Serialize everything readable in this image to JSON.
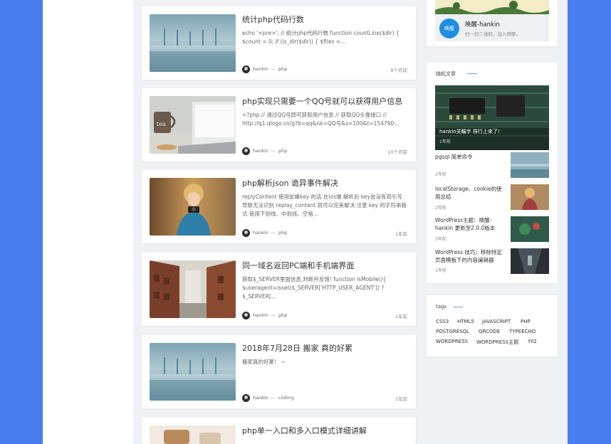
{
  "posts": [
    {
      "title": "统计php代码行数",
      "excerpt": "echo '<pre>'; // 统计php代码行数 function countLine($dir) { $count = 0; if (is_dir($dir)) { $files =…",
      "author": "hankin",
      "dash": "—",
      "category": "php",
      "time": "8个月前",
      "thumb_icon": "bridge-photo"
    },
    {
      "title": "php实现只需要一个QQ号就可以获得用户信息",
      "excerpt": "<?php // 通过QQ号即可获取用户信息 // 获取QQ头像接口 // http://q1.qlogo.cn/g?b=qq&nk=QQ号&s=100&t=154790…",
      "author": "hankin",
      "dash": "—",
      "category": "php",
      "time": "10个月前",
      "thumb_icon": "mug-laptop-photo"
    },
    {
      "title": "php解析json 诡异事件解决",
      "excerpt": "replyContent 使用驼峰key 的话 在ios端 解析后 key会没有双引号导致无法识别 replay_content 就可以完美解决 注意 key 的字符串格式 使用下划线、中划线、空格…",
      "author": "hankin",
      "dash": "—",
      "category": "php",
      "time": "1年前",
      "thumb_icon": "girl-camera-photo"
    },
    {
      "title": "同一域名返回PC端和手机端界面",
      "excerpt": "获取$_SERVER里面信息,判断并反馈! function isMobile(){ $useragent=isset($_SERVER['HTTP_USER_AGENT']) ? $_SERVER[…",
      "author": "hankin",
      "dash": "—",
      "category": "php",
      "time": "1年前",
      "thumb_icon": "alley-photo"
    },
    {
      "title": "2018年7月28日 搬家 真的好累",
      "excerpt": "搬家真的好累！ ~",
      "author": "hankin",
      "dash": "—",
      "category": "coding",
      "time": "1年前",
      "thumb_icon": "bridge-photo"
    },
    {
      "title": "php单一入口和多入口模式详细讲解",
      "excerpt": "",
      "author": "",
      "dash": "",
      "category": "",
      "time": "",
      "thumb_icon": "bag-photo"
    }
  ],
  "sidebar": {
    "wechat": {
      "name": "唤醒-hankin",
      "sub": "扫一扫二维码，加入群聊。",
      "logo_text": "唤醒"
    },
    "random": {
      "heading": "随机文章",
      "featured_caption": "hankin关瞩字 排行上来了!",
      "featured_time": "1年前",
      "items": [
        {
          "title": "pgsql 简单命令",
          "time": "2年前"
        },
        {
          "title": "localStorage、cookie的使用总结",
          "time": "2年前"
        },
        {
          "title": "WordPress主题：唤醒-hankin 更新至2.0.0版本",
          "time": "2年前"
        },
        {
          "title": "WordPress 技巧：移除特定页面模板下的内容编辑器",
          "time": "1年前"
        }
      ]
    },
    "tags": {
      "heading": "tags",
      "items": [
        "CSS3",
        "HTML5",
        "JAVASCRIPT",
        "PHP",
        "POSTGRESQL",
        "QRCODE",
        "TYPEECHO",
        "WORDPRESS",
        "WORDPRESS主题",
        "YII2"
      ]
    }
  },
  "colors": {
    "page_bg": "#4a7ef0",
    "accent": "#5b9cf5"
  }
}
